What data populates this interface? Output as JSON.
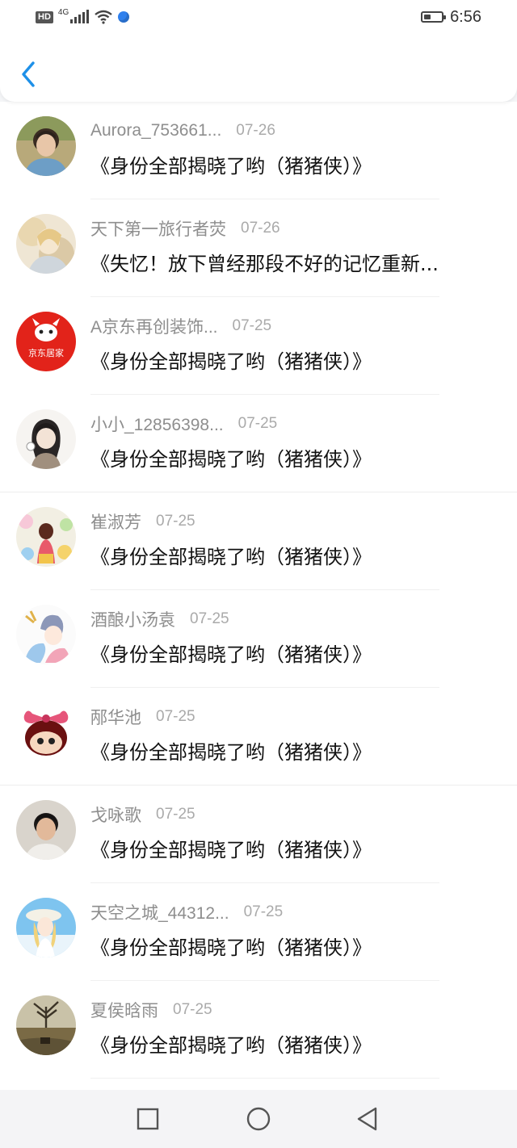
{
  "status_bar": {
    "hd": "HD",
    "network": "4G",
    "time": "6:56",
    "battery_level": 0.4
  },
  "header": {
    "back_icon": "chevron-left-icon"
  },
  "accent_color": "#1e90e8",
  "items": [
    {
      "name": "Aurora_753661...",
      "date": "07-26",
      "title": "《身份全部揭晓了哟（猪猪侠）》"
    },
    {
      "name": "天下第一旅行者荧",
      "date": "07-26",
      "title": "《失忆！放下曾经那段不好的记忆重新..."
    },
    {
      "name": "A京东再创装饰...",
      "date": "07-25",
      "title": "《身份全部揭晓了哟（猪猪侠）》",
      "avatar_text": "京东居家"
    },
    {
      "name": "小小_12856398...",
      "date": "07-25",
      "title": "《身份全部揭晓了哟（猪猪侠）》"
    },
    {
      "name": "崔淑芳",
      "date": "07-25",
      "title": "《身份全部揭晓了哟（猪猪侠）》"
    },
    {
      "name": "酒酿小汤袁",
      "date": "07-25",
      "title": "《身份全部揭晓了哟（猪猪侠）》"
    },
    {
      "name": "邴华池",
      "date": "07-25",
      "title": "《身份全部揭晓了哟（猪猪侠）》"
    },
    {
      "name": "戈咏歌",
      "date": "07-25",
      "title": "《身份全部揭晓了哟（猪猪侠）》"
    },
    {
      "name": "天空之城_44312...",
      "date": "07-25",
      "title": "《身份全部揭晓了哟（猪猪侠）》"
    },
    {
      "name": "夏侯晗雨",
      "date": "07-25",
      "title": "《身份全部揭晓了哟（猪猪侠）》"
    }
  ],
  "nav_bar": {
    "recent_icon": "square-icon",
    "home_icon": "circle-icon",
    "back_icon": "triangle-back-icon"
  }
}
